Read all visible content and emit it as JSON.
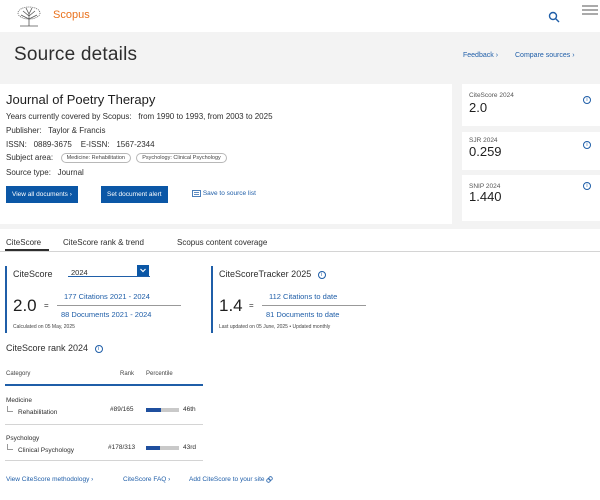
{
  "header": {
    "brand": "Scopus"
  },
  "page": {
    "title": "Source details",
    "links": {
      "feedback": "Feedback",
      "compare": "Compare sources"
    }
  },
  "source": {
    "title": "Journal of Poetry Therapy",
    "coverage_label": "Years currently covered by Scopus:",
    "coverage_value": "from 1990 to 1993, from 2003 to 2025",
    "publisher_label": "Publisher:",
    "publisher_value": "Taylor & Francis",
    "issn_label": "ISSN:",
    "issn_value": "0889-3675",
    "eissn_label": "E-ISSN:",
    "eissn_value": "1567-2344",
    "subject_label": "Subject area:",
    "subject_chips": [
      "Medicine: Rehabilitation",
      "Psychology: Clinical Psychology"
    ],
    "type_label": "Source type:",
    "type_value": "Journal",
    "view_all_btn": "View all documents",
    "alert_btn": "Set document alert",
    "save_link": "Save to source list"
  },
  "metrics": [
    {
      "label": "CiteScore 2024",
      "value": "2.0"
    },
    {
      "label": "SJR 2024",
      "value": "0.259"
    },
    {
      "label": "SNIP 2024",
      "value": "1.440"
    }
  ],
  "tabs": [
    "CiteScore",
    "CiteScore rank & trend",
    "Scopus content coverage"
  ],
  "citescore": {
    "heading": "CiteScore",
    "year": "2024",
    "value": "2.0",
    "eq": "=",
    "numerator": "177 Citations 2021 - 2024",
    "denominator": "88 Documents 2021 - 2024",
    "calculated": "Calculated on 05 May, 2025"
  },
  "tracker": {
    "heading": "CiteScoreTracker 2025",
    "value": "1.4",
    "eq": "=",
    "numerator": "112 Citations to date",
    "denominator": "81 Documents to date",
    "updated": "Last updated on 05 June, 2025 • Updated monthly"
  },
  "rank": {
    "heading": "CiteScore rank 2024",
    "col_category": "Category",
    "col_rank": "Rank",
    "col_percentile": "Percentile",
    "rows": [
      {
        "group": "Medicine",
        "subject": "Rehabilitation",
        "rank": "#89/165",
        "percentile_text": "46th",
        "percentile": 46
      },
      {
        "group": "Psychology",
        "subject": "Clinical Psychology",
        "rank": "#178/313",
        "percentile_text": "43rd",
        "percentile": 43
      }
    ]
  },
  "footer_links": {
    "methodology": "View CiteScore methodology",
    "faq": "CiteScore FAQ",
    "add": "Add CiteScore to your site"
  },
  "colors": {
    "accent": "#1f5ea8",
    "brand": "#e9711c",
    "button": "#0b57a6",
    "percentile_fill": "#1f4f9e"
  }
}
